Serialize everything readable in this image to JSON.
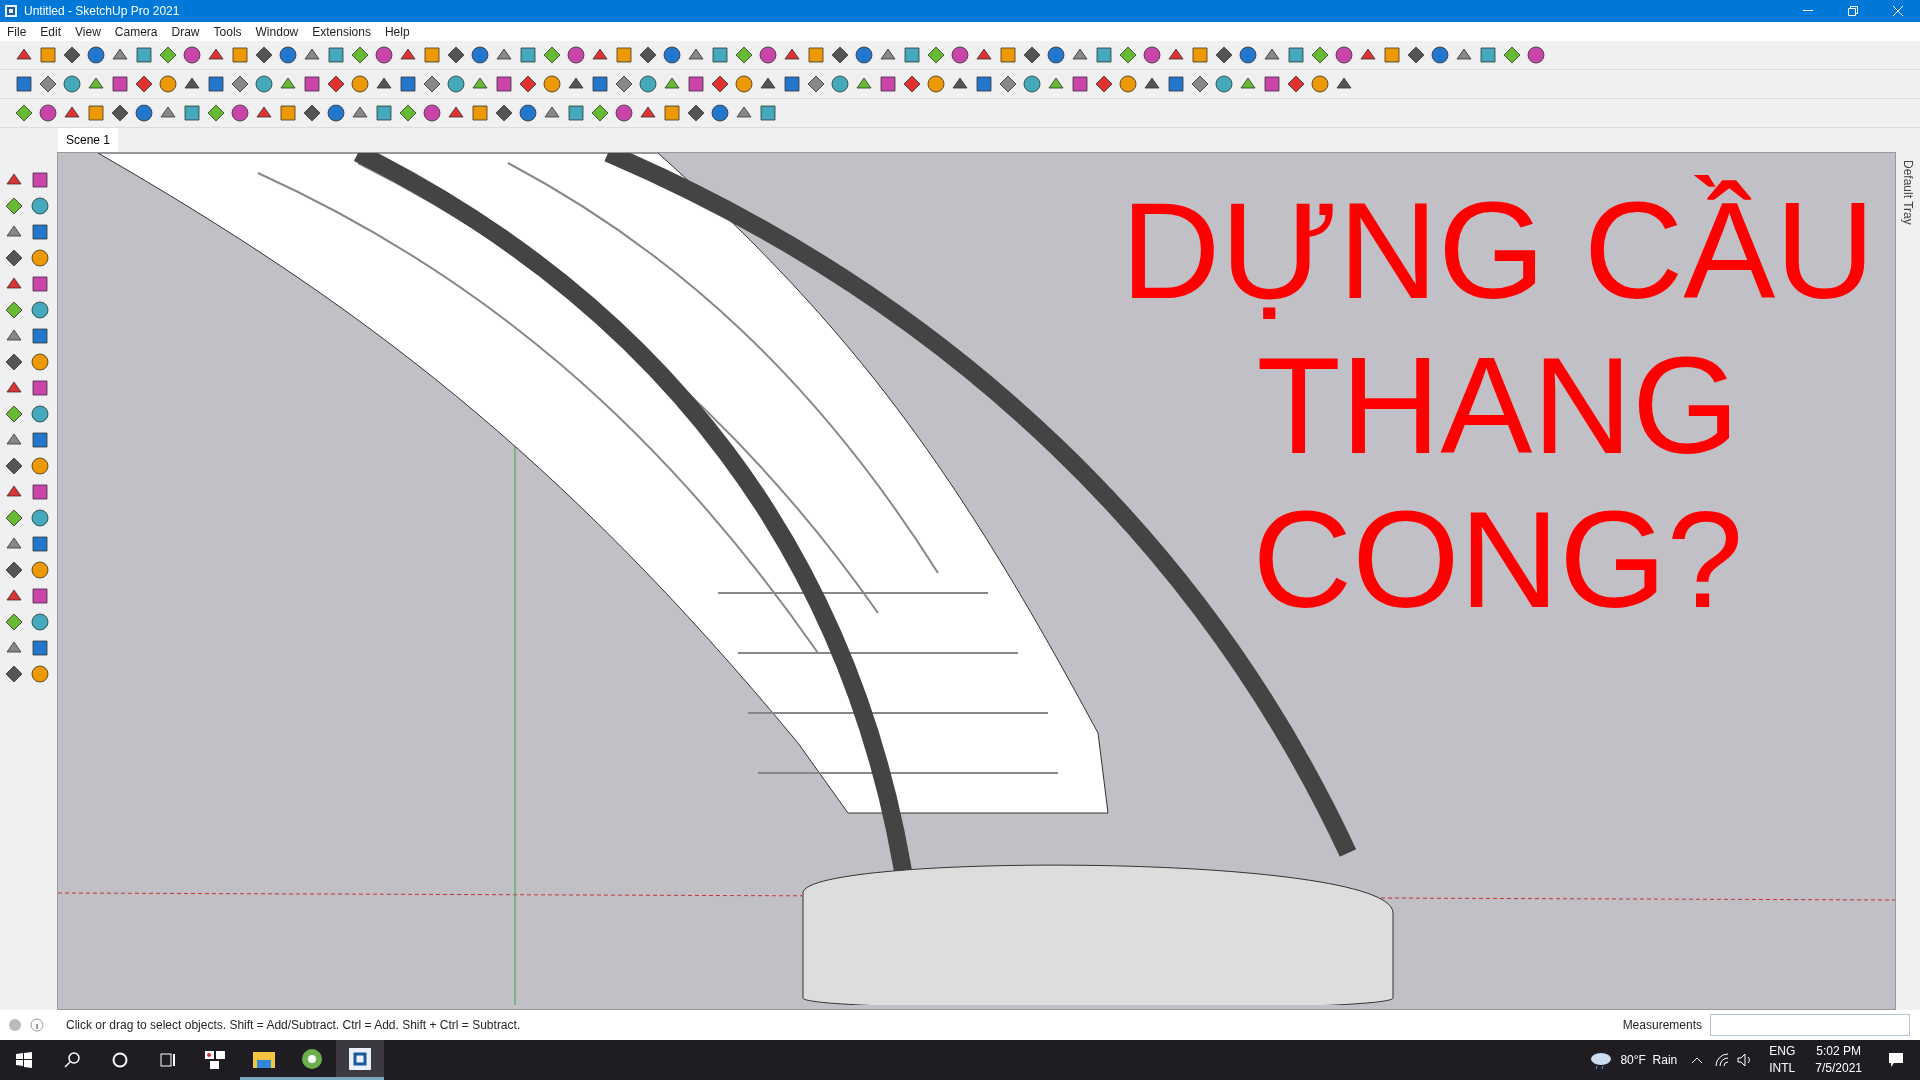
{
  "window": {
    "title": "Untitled - SketchUp Pro 2021"
  },
  "menu": [
    "File",
    "Edit",
    "View",
    "Camera",
    "Draw",
    "Tools",
    "Window",
    "Extensions",
    "Help"
  ],
  "scene_tabs": [
    {
      "label": "Scene 1",
      "selected": true
    }
  ],
  "viewport": {
    "overlay_text": "DỰNG CẦU\nTHANG\nCONG?"
  },
  "tray": {
    "label": "Default Tray"
  },
  "status_bar": {
    "hint": "Click or drag to select objects. Shift = Add/Subtract. Ctrl = Add. Shift + Ctrl = Subtract.",
    "measurements_label": "Measurements"
  },
  "taskbar": {
    "weather": "80°F  Rain",
    "language": [
      "ENG",
      "INTL"
    ],
    "time": "5:02 PM",
    "date": "7/5/2021"
  }
}
